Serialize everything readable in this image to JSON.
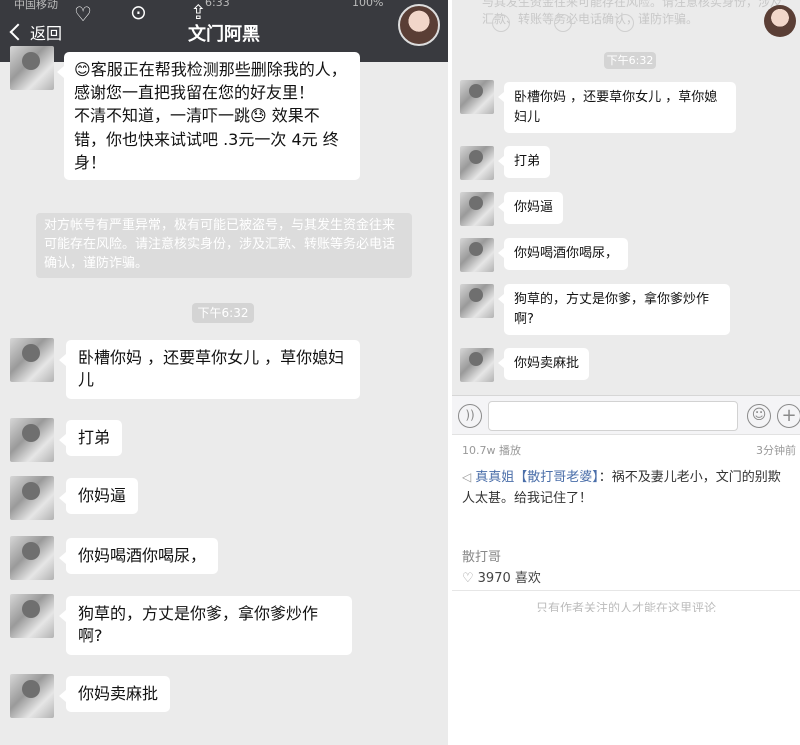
{
  "left": {
    "status": {
      "carrier": "中国移动",
      "time": "6:33",
      "battery": "100%"
    },
    "nav": {
      "back_label": "返回",
      "title": "文门阿黑"
    },
    "prev_message": {
      "emoji": "😊",
      "text": "客服正在帮我检测那些删除我的人，感谢您一直把我留在您的好友里！",
      "text2": "不清不知道，一清吓一跳😓 效果不错，你也快来试试吧 .3元一次 4元 终身！"
    },
    "system_notice": "对方帐号有严重异常，极有可能已被盗号，与其发生资金往来可能存在风险。请注意核实身份，涉及汇款、转账等务必电话确认，谨防诈骗。",
    "time_stamp": "下午6:32",
    "messages": [
      "卧槽你妈 ，还要草你女儿 ，草你媳妇儿",
      "打弟",
      "你妈逼",
      "你妈喝酒你喝尿，",
      "狗草的，方丈是你爹，拿你爹炒作啊?",
      "你妈卖麻批"
    ]
  },
  "right": {
    "top_notice": "与其发生资金往来可能存在风险。请注意核实身份，涉及汇款、转账等务必电话确认，谨防诈骗。",
    "time_stamp": "下午6:32",
    "messages": [
      "卧槽你妈 ，还要草你女儿 ，草你媳妇儿",
      "打弟",
      "你妈逼",
      "你妈喝酒你喝尿，",
      "狗草的，方丈是你爹，拿你爹炒作啊?",
      "你妈卖麻批"
    ],
    "meta": {
      "plays": "10.7w 播放",
      "ago": "3分钟前"
    },
    "comment": {
      "user": "真真姐【散打哥老婆】",
      "sep": "：",
      "text": "祸不及妻儿老小，文门的别欺人太甚。给我记住了！"
    },
    "author": "散打哥",
    "likes": "3970 喜欢",
    "footer": "只有作者关注的人才能在这里评论"
  },
  "icons": {
    "back": "chevron-left-icon",
    "heart": "heart-icon",
    "more": "more-icon",
    "share": "share-icon",
    "voice": "voice-icon",
    "emoji": "emoji-icon",
    "plus": "plus-icon",
    "speaker": "speaker-icon"
  },
  "colors": {
    "nav_bg": "#393a3f",
    "chat_bg": "#ebebeb",
    "bubble": "#ffffff",
    "link": "#4a6ea9"
  }
}
